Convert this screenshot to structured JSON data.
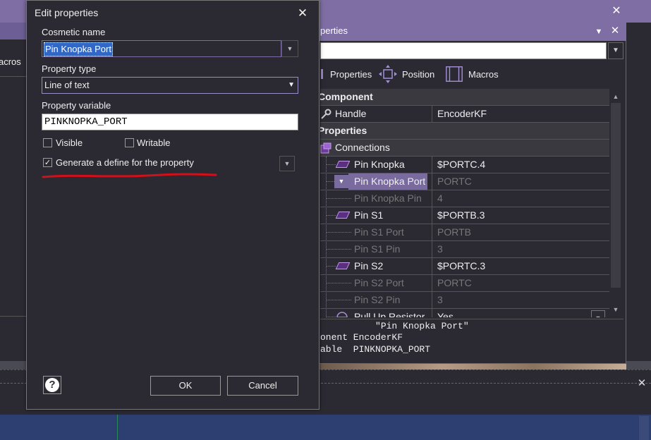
{
  "background": {
    "left_panel_label": "acros"
  },
  "properties_panel": {
    "title": "perties",
    "tabs": [
      {
        "label": "Properties",
        "icon": "properties-icon"
      },
      {
        "label": "Position",
        "icon": "position-icon"
      },
      {
        "label": "Macros",
        "icon": "macros-icon"
      }
    ],
    "grid": {
      "category_component": "Component",
      "handle_label": "Handle",
      "handle_value": "EncoderKF",
      "category_properties": "Properties",
      "connections_label": "Connections",
      "rows": [
        {
          "name": "Pin Knopka",
          "value": "$PORTC.4",
          "enabled": true
        },
        {
          "name": "Pin Knopka Port",
          "value": "PORTC",
          "enabled": false,
          "selected": true
        },
        {
          "name": "Pin Knopka Pin",
          "value": "4",
          "enabled": false
        },
        {
          "name": "Pin S1",
          "value": "$PORTB.3",
          "enabled": true
        },
        {
          "name": "Pin S1 Port",
          "value": "PORTB",
          "enabled": false
        },
        {
          "name": "Pin S1 Pin",
          "value": "3",
          "enabled": false
        },
        {
          "name": "Pin S2",
          "value": "$PORTC.3",
          "enabled": true
        },
        {
          "name": "Pin S2 Port",
          "value": "PORTC",
          "enabled": false
        },
        {
          "name": "Pin S2 Pin",
          "value": "3",
          "enabled": false
        },
        {
          "name": "Pull Up Resistor",
          "value": "Yes",
          "enabled": true
        }
      ]
    },
    "description": {
      "line1": "          \"Pin Knopka Port\"",
      "line2": "onent EncoderKF",
      "line3": "able  PINKNOPKA_PORT"
    }
  },
  "dialog": {
    "title": "Edit properties",
    "cosmetic_name_label": "Cosmetic name",
    "cosmetic_name_value": "Pin Knopka Port",
    "property_type_label": "Property type",
    "property_type_value": "Line of text",
    "property_variable_label": "Property variable",
    "property_variable_value": "PINKNOPKA_PORT",
    "visible_label": "Visible",
    "visible_checked": false,
    "writable_label": "Writable",
    "writable_checked": false,
    "generate_define_label": "Generate a define for the property",
    "generate_define_checked": true,
    "ok_label": "OK",
    "cancel_label": "Cancel",
    "help_glyph": "?",
    "accent_color": "#7e6ea3",
    "annotation_color": "#d0101a"
  }
}
